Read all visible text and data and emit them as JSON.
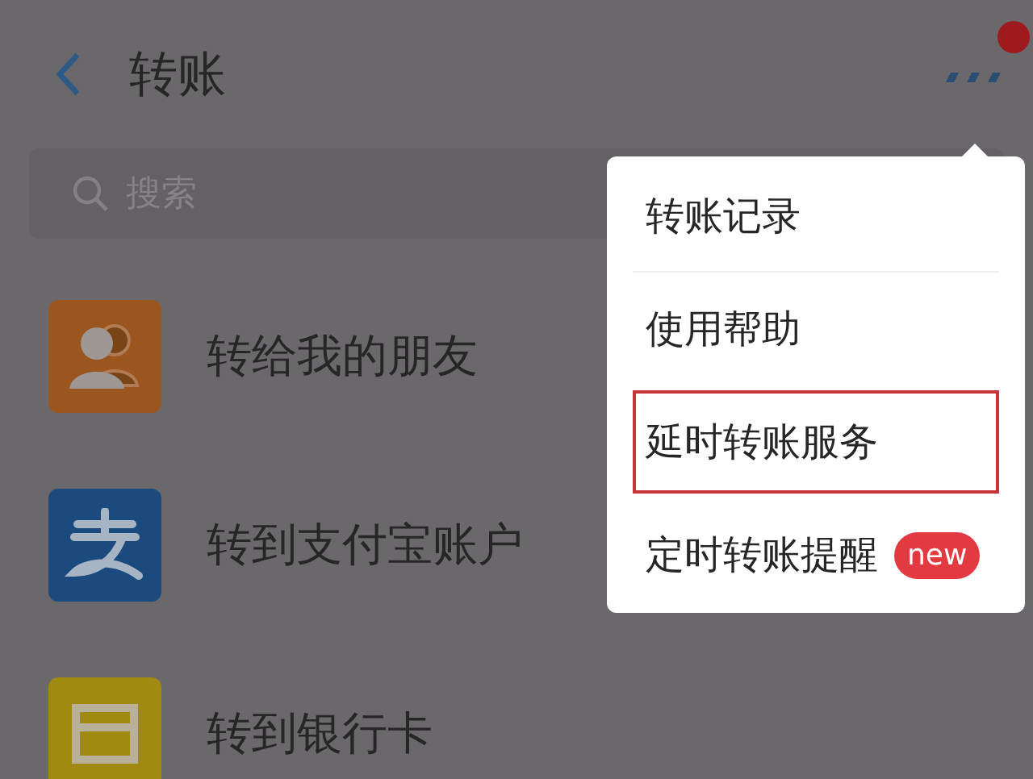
{
  "header": {
    "title": "转账",
    "notification": true
  },
  "search": {
    "placeholder": "搜索"
  },
  "options": [
    {
      "kind": "friends",
      "label": "转给我的朋友"
    },
    {
      "kind": "alipay",
      "label": "转到支付宝账户"
    },
    {
      "kind": "bank",
      "label": "转到银行卡"
    }
  ],
  "menu": {
    "items": [
      {
        "label": "转账记录",
        "highlighted": false
      },
      {
        "label": "使用帮助",
        "highlighted": false
      },
      {
        "label": "延时转账服务",
        "highlighted": true
      },
      {
        "label": "定时转账提醒",
        "highlighted": false,
        "badge": "new"
      }
    ]
  }
}
